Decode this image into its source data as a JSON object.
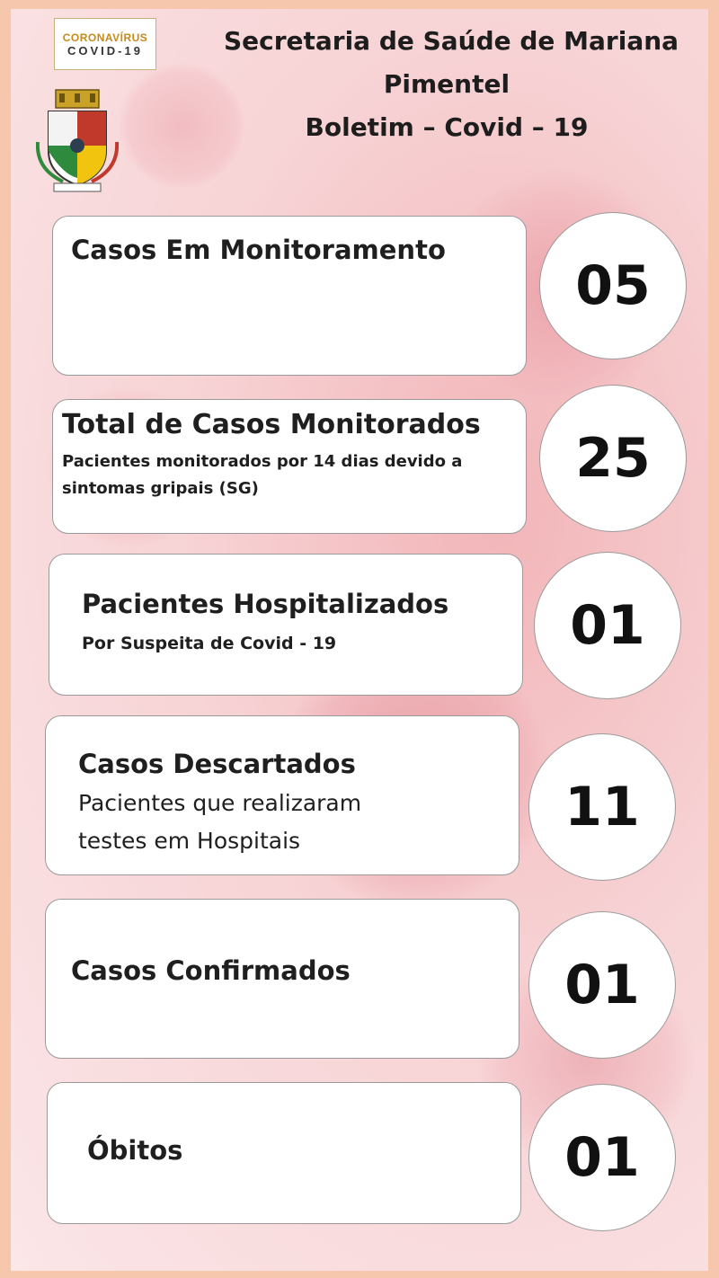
{
  "badge": {
    "top": "CORONAVÍRUS",
    "bottom": "COVID-19"
  },
  "header": {
    "line1": "Secretaria de Saúde de Mariana",
    "line2": "Pimentel",
    "line3": "Boletim – Covid – 19"
  },
  "cards": [
    {
      "title": "Casos Em Monitoramento",
      "subtitle": "",
      "value": "05"
    },
    {
      "title": "Total de Casos Monitorados",
      "subtitle_line1": "Pacientes monitorados por 14 dias devido a",
      "subtitle_line2": "sintomas gripais (SG)",
      "value": "25"
    },
    {
      "title": "Pacientes Hospitalizados",
      "subtitle": "Por Suspeita de Covid - 19",
      "value": "01"
    },
    {
      "title": "Casos Descartados",
      "subtitle_line1": "Pacientes que realizaram",
      "subtitle_line2": "testes em Hospitais",
      "value": "11"
    },
    {
      "title": "Casos Confirmados",
      "subtitle": "",
      "value": "01"
    },
    {
      "title": "Óbitos",
      "subtitle": "",
      "value": "01"
    }
  ],
  "colors": {
    "page_border": "#f6c7ad",
    "background": "#f7d3d5",
    "card": "#ffffff",
    "text": "#1f1f1f",
    "badge_accent": "#c58a1a"
  },
  "icons": {
    "logo": "coronavirus-covid19-badge",
    "crest": "municipal-coat-of-arms"
  }
}
